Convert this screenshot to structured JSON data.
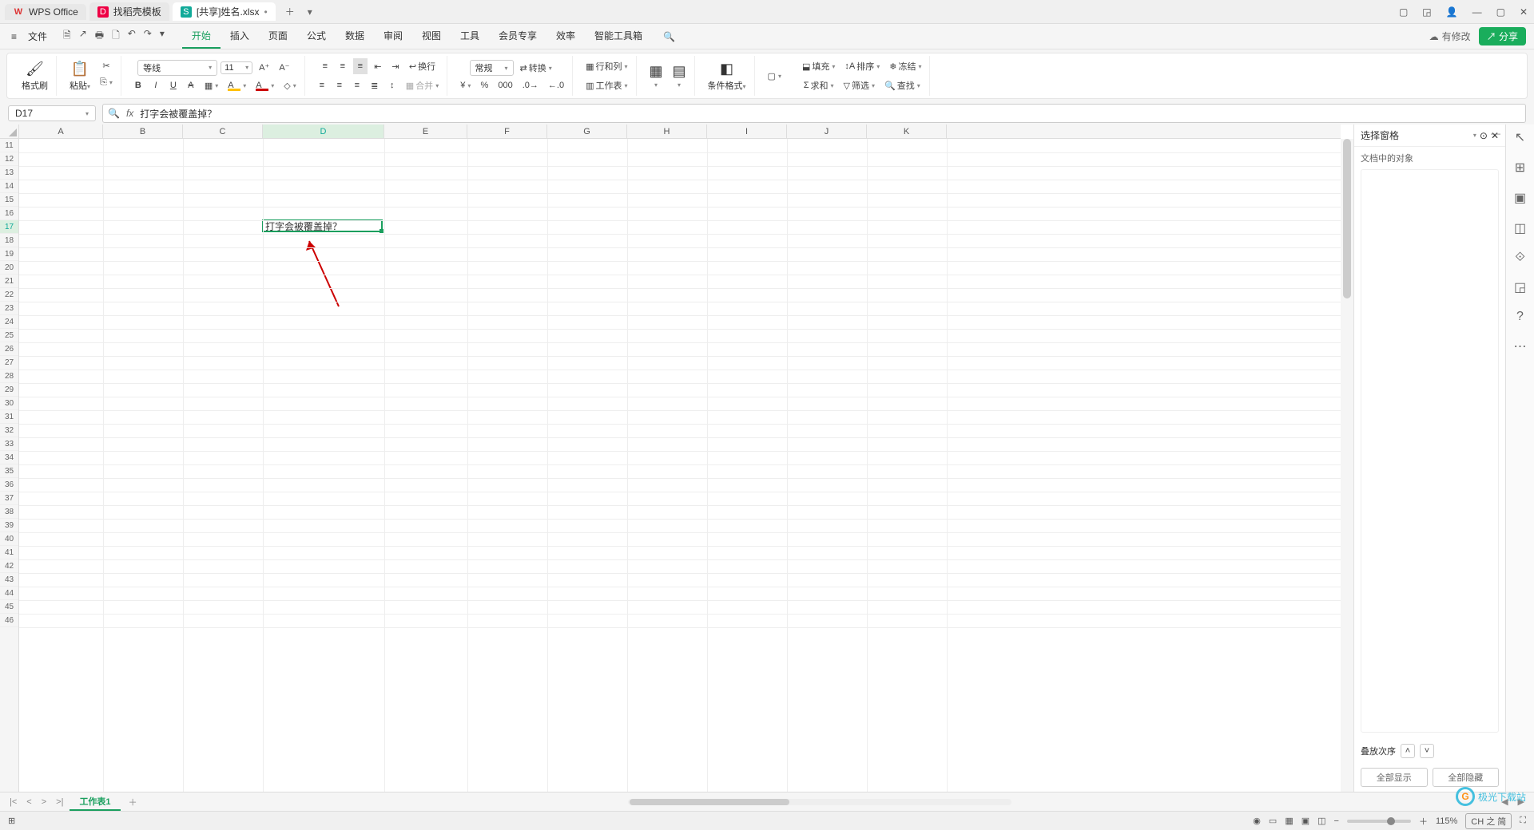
{
  "titlebar": {
    "tabs": [
      {
        "icon": "W",
        "label": "WPS Office"
      },
      {
        "icon": "D",
        "label": "找稻壳模板"
      },
      {
        "icon": "S",
        "label": "[共享]姓名.xlsx",
        "dirty": "•"
      }
    ]
  },
  "menubar": {
    "file": "文件",
    "items": [
      "开始",
      "插入",
      "页面",
      "公式",
      "数据",
      "审阅",
      "视图",
      "工具",
      "会员专享",
      "效率",
      "智能工具箱"
    ],
    "active": 0,
    "edit_flag": "有修改",
    "share": "分享"
  },
  "ribbon": {
    "format_painter": "格式刷",
    "paste": "粘贴",
    "font": "等线",
    "size": "11",
    "wrap": "换行",
    "merge": "合并",
    "numfmt": "常规",
    "convert": "转换",
    "rowcol": "行和列",
    "sheet": "工作表",
    "condfmt": "条件格式",
    "fill": "填充",
    "sort": "排序",
    "freeze": "冻结",
    "sum": "求和",
    "filter": "筛选",
    "find": "查找"
  },
  "namebox": "D17",
  "formula": "打字会被覆盖掉？",
  "grid": {
    "cols": [
      "A",
      "B",
      "C",
      "D",
      "E",
      "F",
      "G",
      "H",
      "I",
      "J",
      "K"
    ],
    "selcol": 3,
    "row_start": 11,
    "row_end": 46,
    "selrow": 17,
    "active": {
      "row": 17,
      "col": 3,
      "text": "打字会被覆盖掉？"
    }
  },
  "rpanel": {
    "title": "选择窗格",
    "subtitle": "文档中的对象",
    "order": "叠放次序",
    "show_all": "全部显示",
    "hide_all": "全部隐藏"
  },
  "sheettabs": {
    "active": "工作表1"
  },
  "status": {
    "zoom": "115%",
    "ime": "CH 之 简"
  },
  "watermark": "极光下载站"
}
